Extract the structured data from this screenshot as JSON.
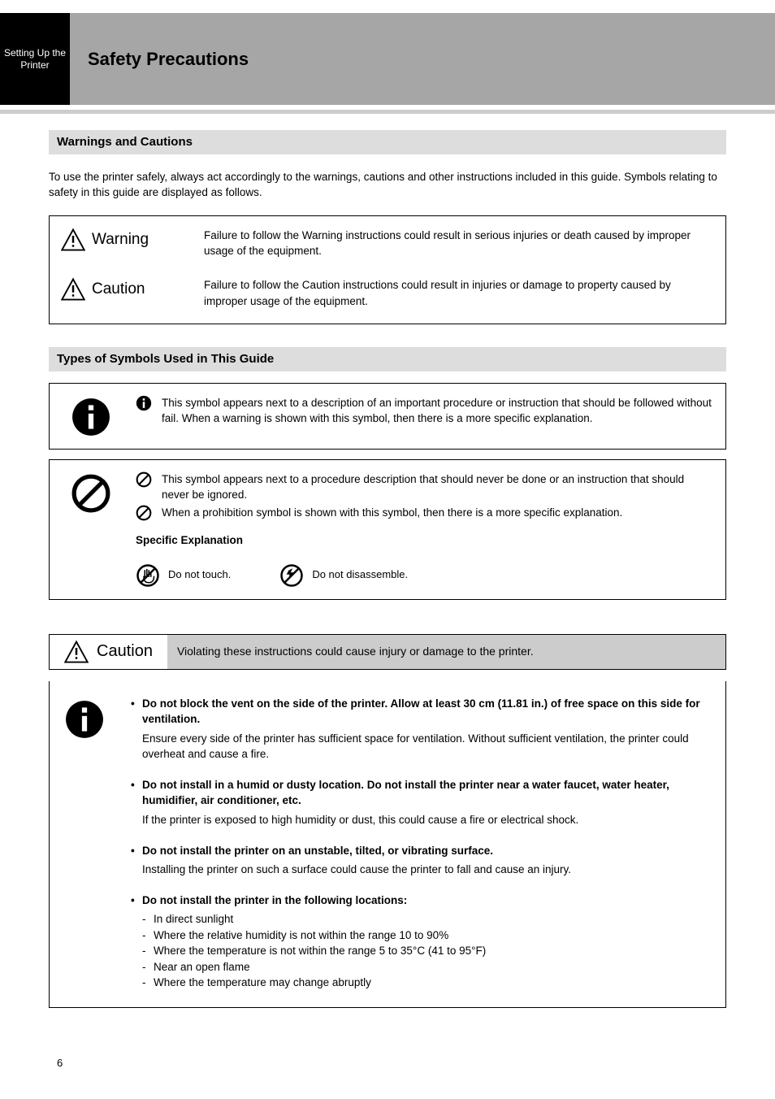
{
  "header": {
    "tab_lines": [
      "Setting Up the",
      "Printer"
    ],
    "title": "Safety Precautions"
  },
  "section1": {
    "heading": "Warnings and Cautions"
  },
  "intro": "To use the printer safely, always act accordingly to the warnings, cautions and other instructions included in this guide. Symbols relating to safety in this guide are displayed as follows.",
  "wc": {
    "warning_label": "Warning",
    "warning_desc": "Failure to follow the Warning instructions could result in serious injuries or death caused by improper usage of the equipment.",
    "caution_label": "Caution",
    "caution_desc": "Failure to follow the Caution instructions could result in injuries or damage to property caused by improper usage of the equipment."
  },
  "section2": {
    "heading": "Types of Symbols Used in This Guide"
  },
  "sym_instr": {
    "row_lead": "This symbol appears next to a description of an important procedure or instruction that should be followed without fail.",
    "inline_tail": "When a warning is shown with this symbol, then there is a more specific explanation."
  },
  "sym_prohibit": {
    "row_lead": "This symbol appears next to a procedure description that should never be done or an instruction that should never be ignored.",
    "inline_tail": "When a prohibition symbol is shown with this symbol, then there is a more specific explanation."
  },
  "specific_examples_heading": "Specific Explanation",
  "examples": {
    "do_not_touch": "Do not touch.",
    "do_not_disassemble": "Do not disassemble."
  },
  "caution_bar": {
    "label": "Caution",
    "right": "Violating these instructions could cause injury or damage to the printer."
  },
  "bigbox": {
    "b1": "Do not block the vent on the side of the printer. Allow at least 30 cm (11.81 in.) of free space on this side for ventilation.",
    "b1_sub": "Ensure every side of the printer has sufficient space for ventilation. Without sufficient ventilation, the printer could overheat and cause a fire.",
    "b2": "Do not install in a humid or dusty location. Do not install the printer near a water faucet, water heater, humidifier, air conditioner, etc.",
    "b2_sub": "If the printer is exposed to high humidity or dust, this could cause a fire or electrical shock.",
    "b3": "Do not install the printer on an unstable, tilted, or vibrating surface.",
    "b3_sub": "Installing the printer on such a surface could cause the printer to fall and cause an injury.",
    "b4": "Do not install the printer in the following locations:",
    "b4_list": [
      "In direct sunlight",
      "Where the relative humidity is not within the range 10 to 90%",
      "Where the temperature is not within the range 5 to 35°C (41 to 95°F)",
      "Near an open flame",
      "Where the temperature may change abruptly"
    ]
  },
  "page_number": "6"
}
